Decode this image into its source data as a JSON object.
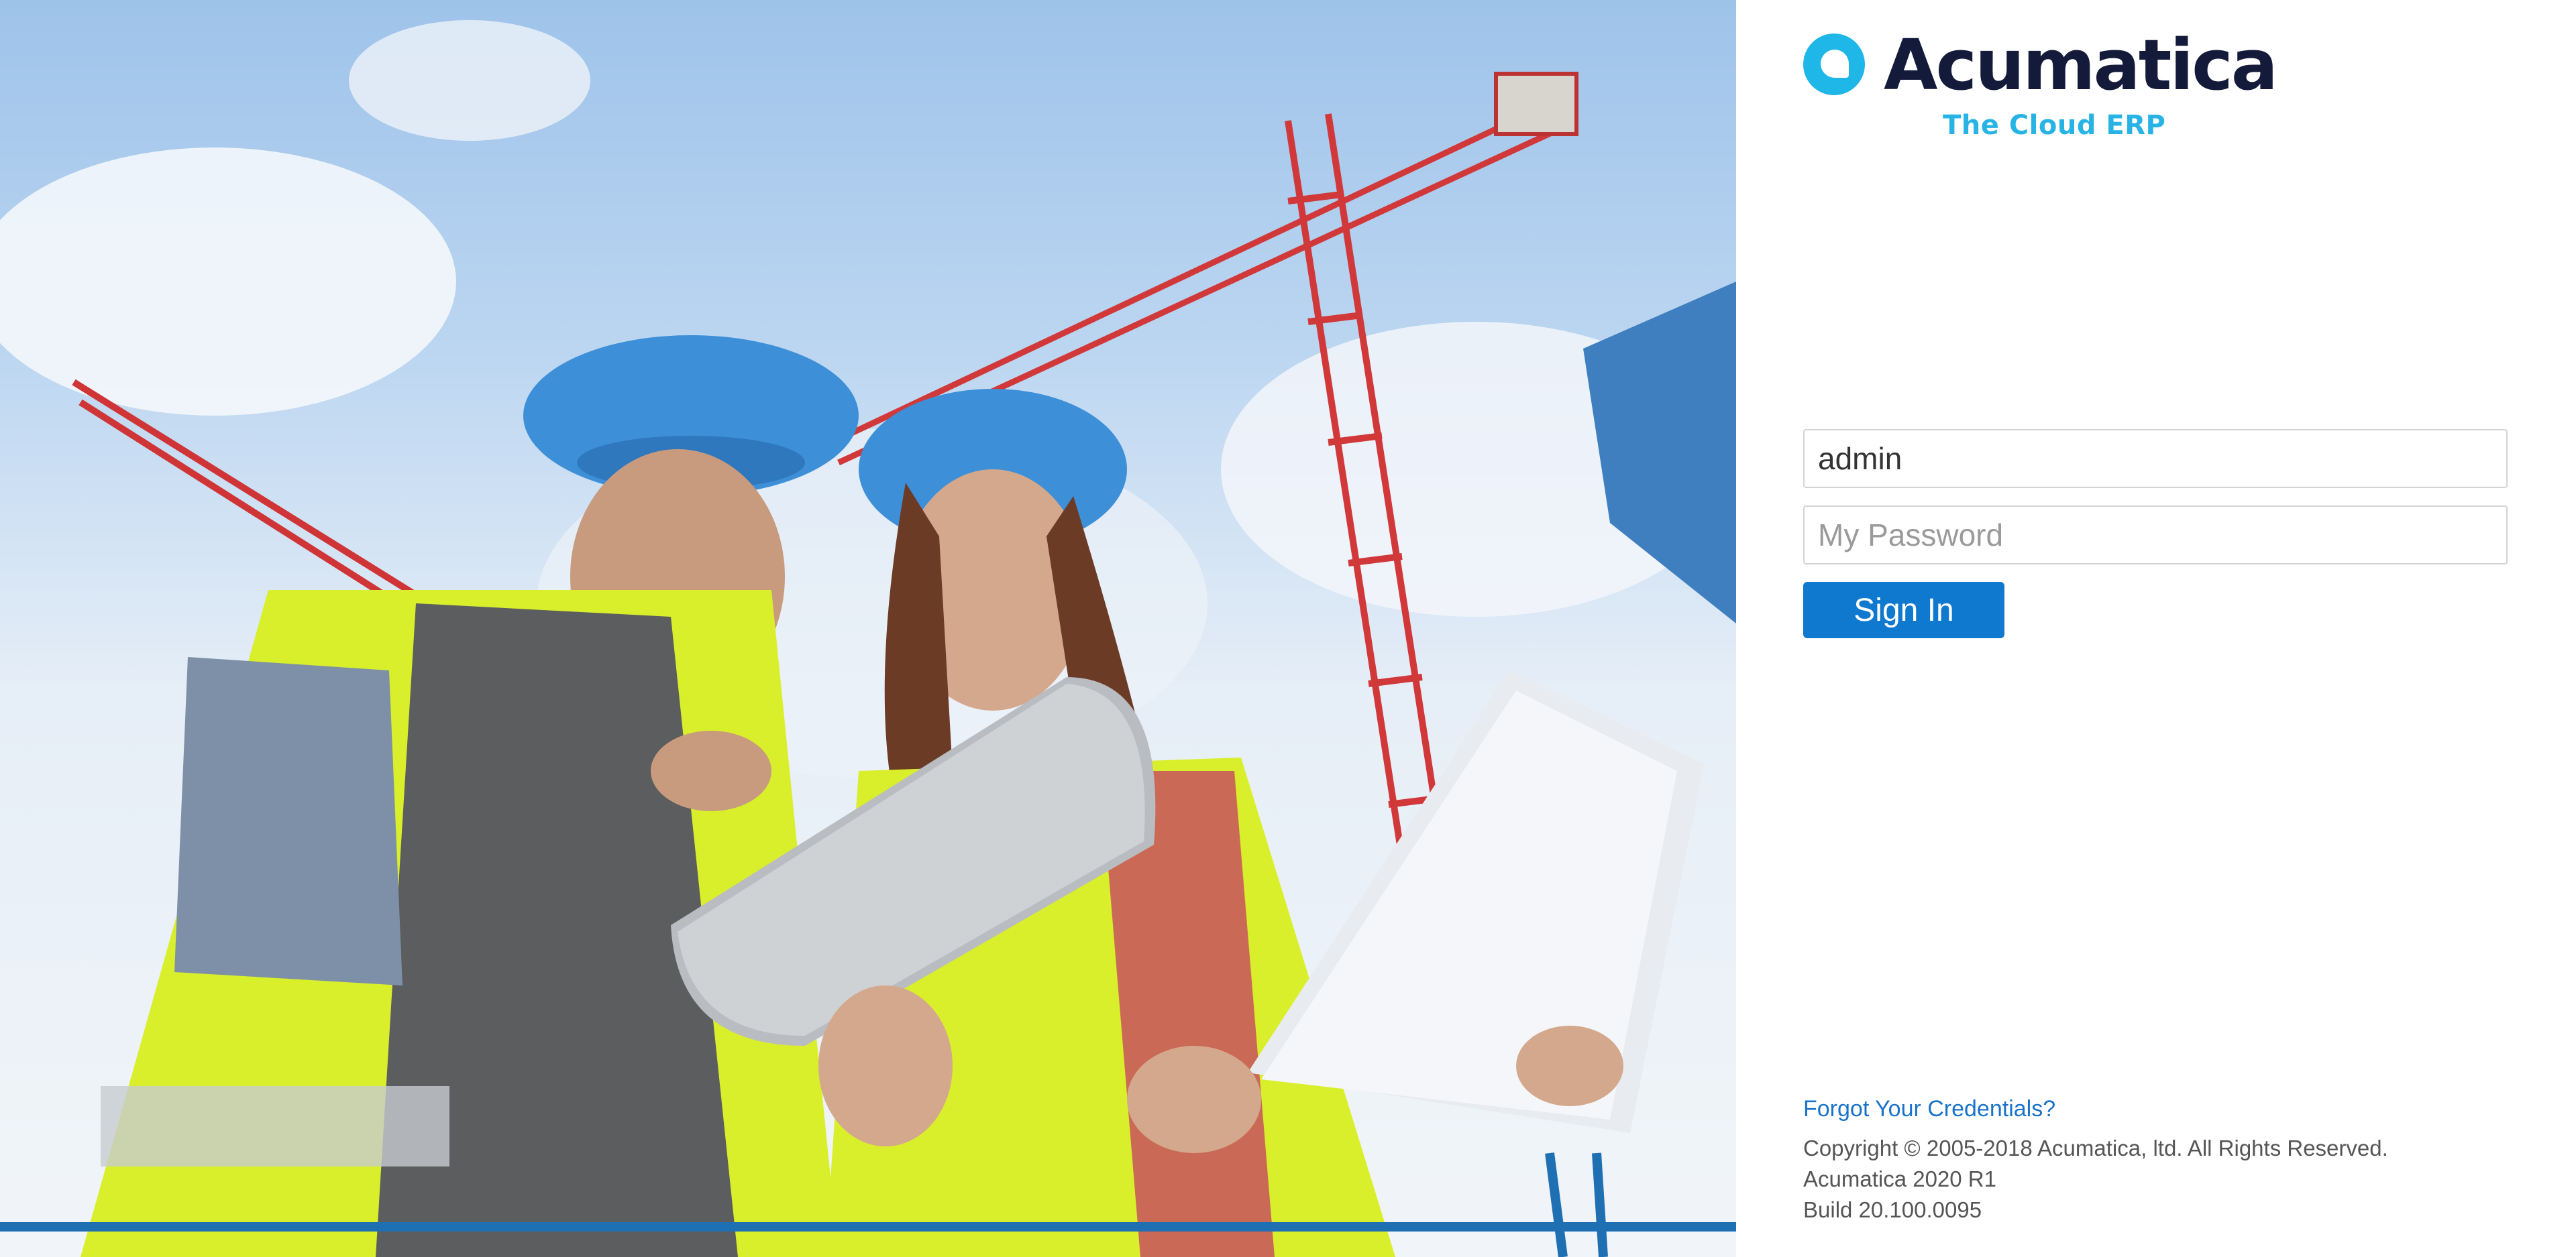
{
  "brand": {
    "name": "Acumatica",
    "tagline": "The Cloud ERP",
    "colors": {
      "accent": "#1fb6e8",
      "wordmark": "#141a3a",
      "primary_button": "#0f78cf",
      "link": "#1a73c9"
    }
  },
  "hero": {
    "icon": "construction-workers-photo"
  },
  "login": {
    "username_value": "admin",
    "password_placeholder": "My Password",
    "signin_label": "Sign In"
  },
  "footer": {
    "forgot_label": "Forgot Your Credentials?",
    "copyright": "Copyright © 2005-2018 Acumatica, ltd. All Rights Reserved.",
    "version": "Acumatica 2020 R1",
    "build": "Build 20.100.0095"
  }
}
